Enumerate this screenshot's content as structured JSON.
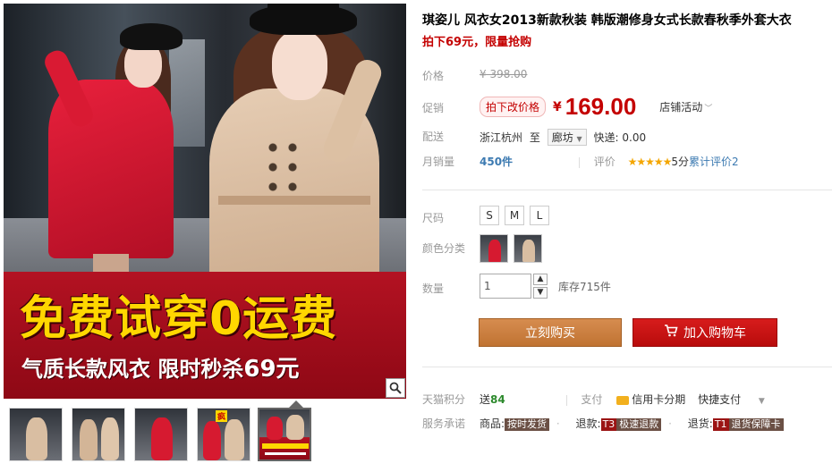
{
  "gallery": {
    "promo_line1": "免费试穿0运费",
    "promo_line2_text": "气质长款风衣  限时秒杀",
    "promo_line2_price": "69元",
    "thumbnails": [
      {
        "style": "beige-coat"
      },
      {
        "style": "beige-pair"
      },
      {
        "style": "red-coat"
      },
      {
        "style": "red-beige-pair",
        "badge": "疯"
      },
      {
        "style": "promo",
        "active": true
      }
    ]
  },
  "product": {
    "title": "琪姿儿 风衣女2013新款秋装 韩版潮修身女式长款春秋季外套大衣",
    "subtitle": "拍下69元，限量抢购",
    "price_label": "价格",
    "orig_price": "¥ 398.00",
    "promo_label": "促销",
    "promo_tag": "拍下改价格",
    "cur_currency": "¥",
    "cur_price": "169.00",
    "store_activity": "店铺活动",
    "ship_label": "配送",
    "ship_from": "浙江杭州",
    "ship_to_word": "至",
    "ship_city": "廊坊",
    "ship_fee": "快递: 0.00",
    "monthly_label": "月销量",
    "monthly_count": "450件",
    "rating_label": "评价",
    "rating_stars": "★★★★★",
    "rating_score": "5分",
    "review_text": "累计评价2",
    "size_label": "尺码",
    "sizes": [
      "S",
      "M",
      "L"
    ],
    "color_label": "颜色分类",
    "qty_label": "数量",
    "qty_value": "1",
    "stock": "库存715件",
    "buy_now": "立刻购买",
    "add_cart": "加入购物车",
    "points_label": "天猫积分",
    "points_prefix": "送",
    "points_value": "84",
    "pay_label": "支付",
    "pay_credit": "信用卡分期",
    "pay_quick": "快捷支付",
    "service_label": "服务承诺",
    "svc_goods": "商品:",
    "svc_goods_tag": "按时发货",
    "svc_refund": "退款:",
    "svc_refund_code": "T3",
    "svc_refund_tag": "极速退款",
    "svc_return": "退货:",
    "svc_return_code": "T1",
    "svc_return_tag": "退货保障卡"
  },
  "colors": {
    "price_red": "#c40000",
    "banner_red": "#b31222",
    "buy_orange": "#c07332",
    "cart_red": "#c80f0f"
  }
}
